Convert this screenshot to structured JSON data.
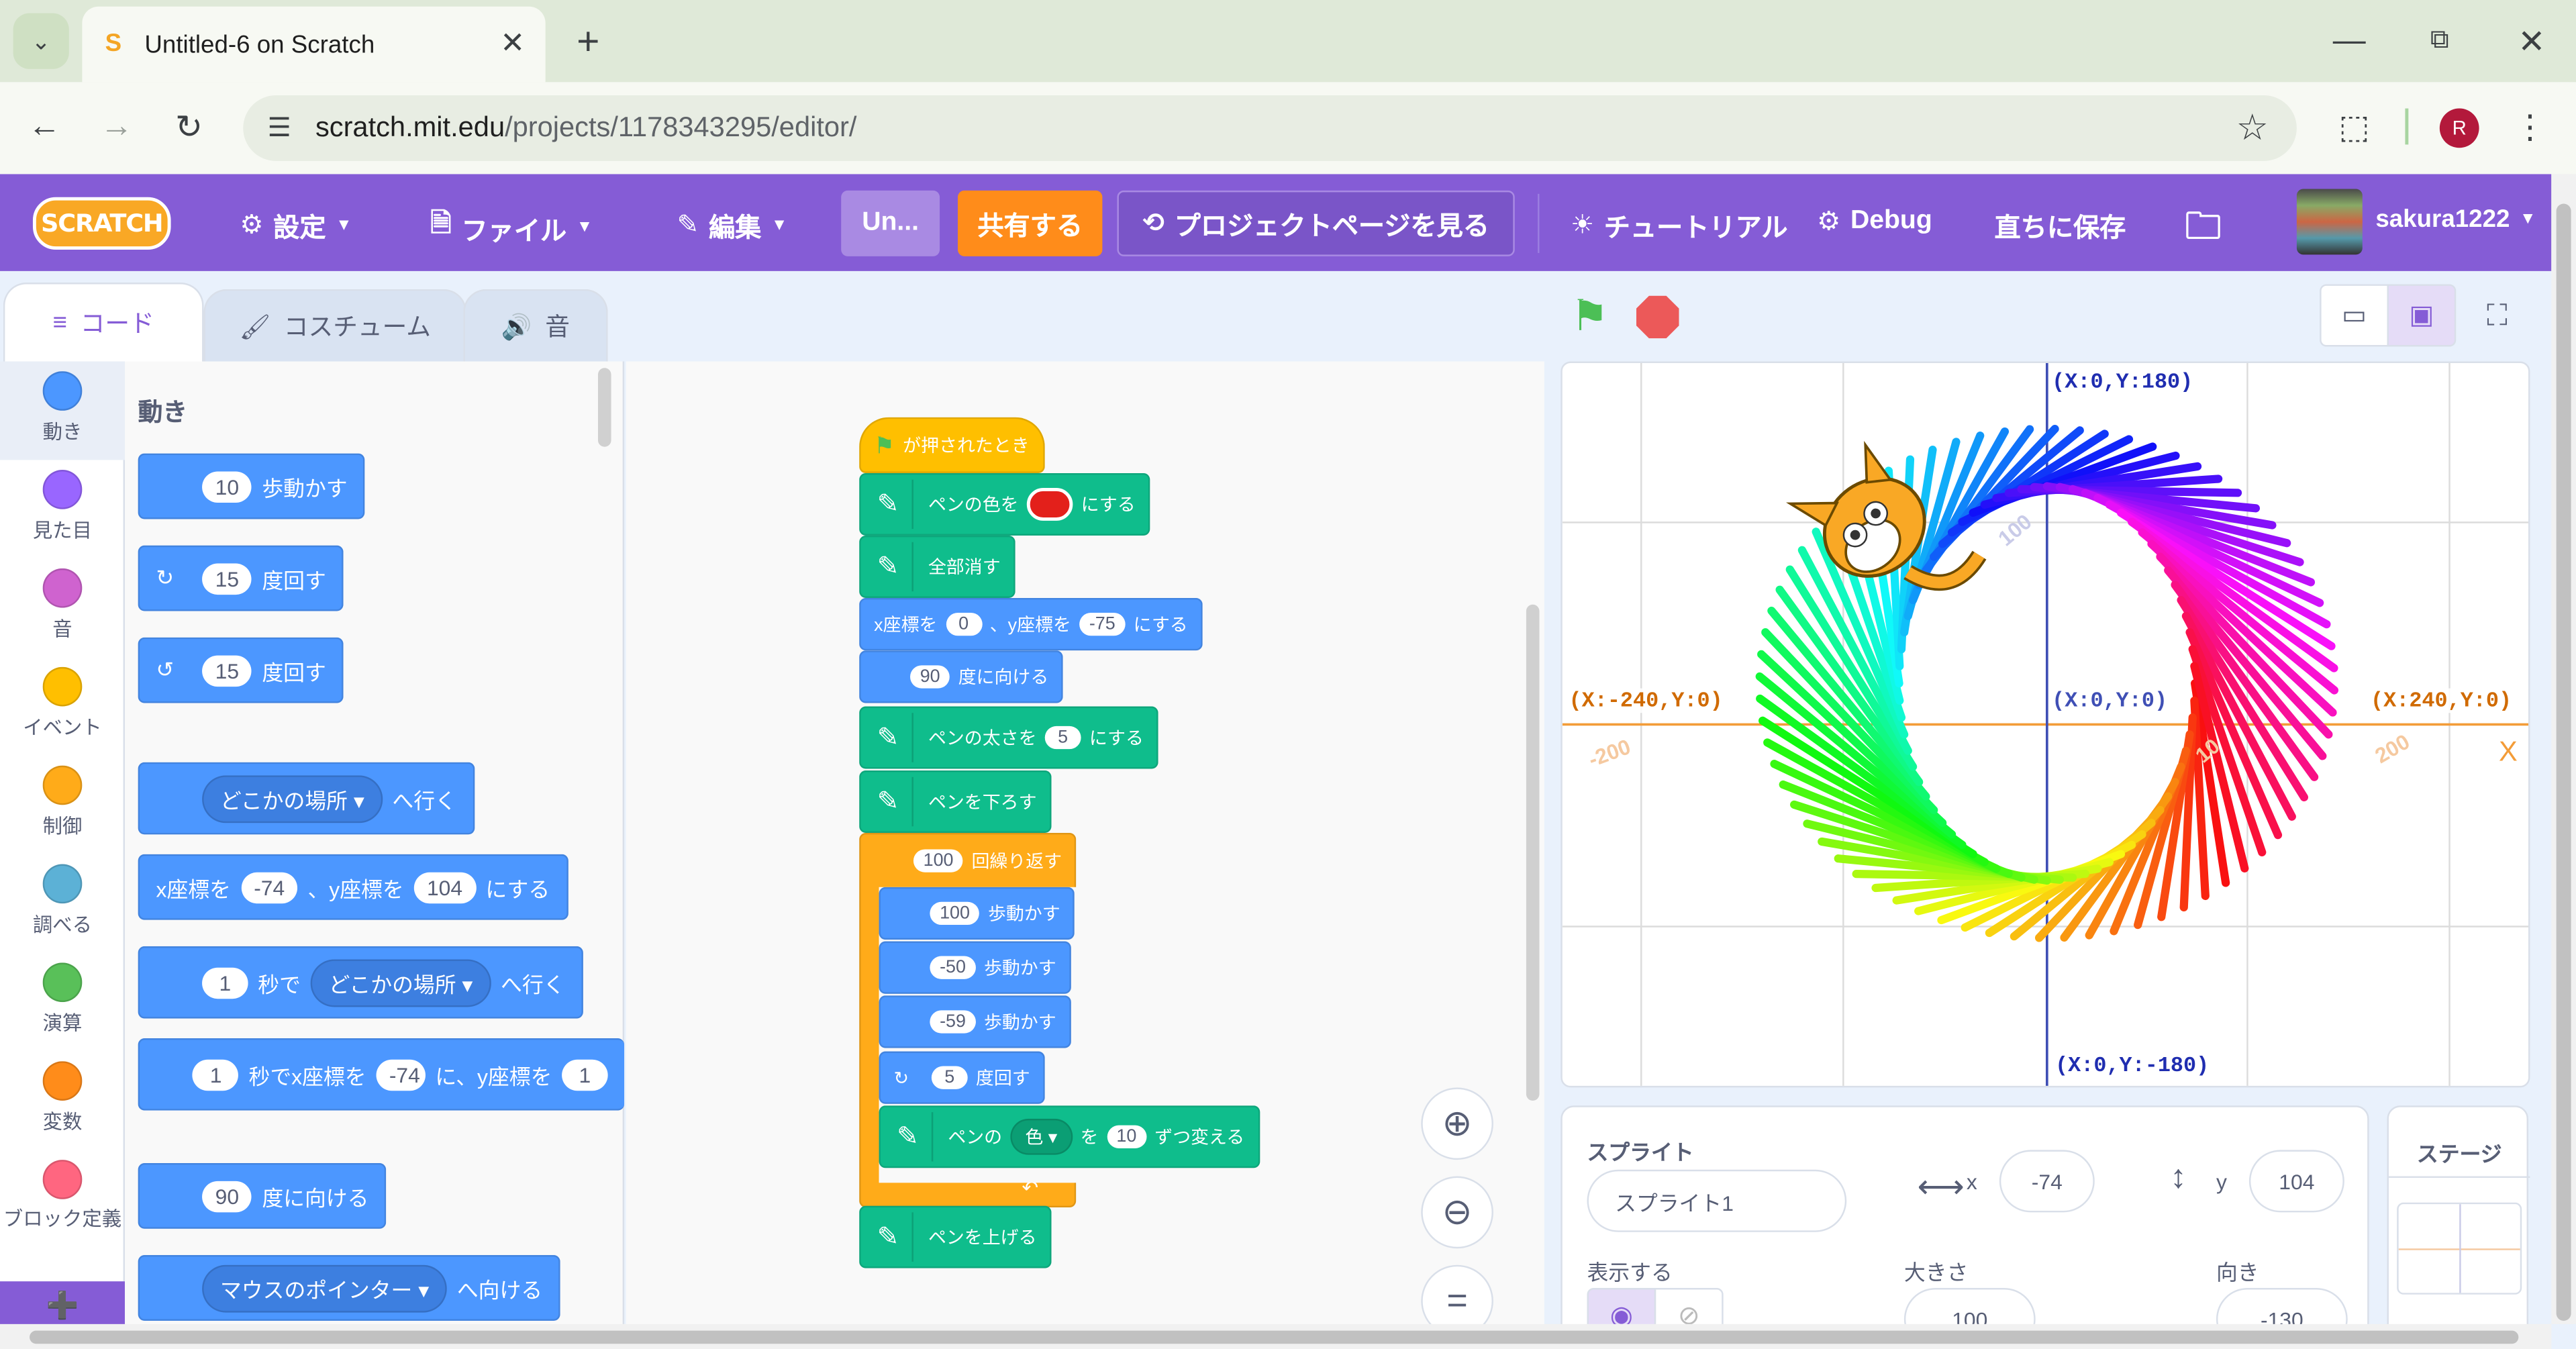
{
  "browser": {
    "tab_title": "Untitled-6 on Scratch",
    "url_domain": "scratch.mit.edu",
    "url_path": "/projects/1178343295/editor/",
    "profile_initial": "R"
  },
  "menubar": {
    "logo": "SCRATCH",
    "settings": "設定",
    "file": "ファイル",
    "edit": "編集",
    "project_title": "Un...",
    "share": "共有する",
    "see_project_page": "プロジェクトページを見る",
    "tutorials": "チュートリアル",
    "debug": "Debug",
    "save_now": "直ちに保存",
    "username": "sakura1222"
  },
  "editor_tabs": {
    "code": "コード",
    "costumes": "コスチューム",
    "sounds": "音"
  },
  "categories": [
    {
      "label": "動き",
      "color": "#4c97ff"
    },
    {
      "label": "見た目",
      "color": "#9966ff"
    },
    {
      "label": "音",
      "color": "#cf63cf"
    },
    {
      "label": "イベント",
      "color": "#ffbf00"
    },
    {
      "label": "制御",
      "color": "#ffab19"
    },
    {
      "label": "調べる",
      "color": "#5cb1d6"
    },
    {
      "label": "演算",
      "color": "#59c059"
    },
    {
      "label": "変数",
      "color": "#ff8c1a"
    },
    {
      "label": "ブロック定義",
      "color": "#ff6680"
    }
  ],
  "palette": {
    "heading": "動き",
    "move_steps": {
      "value": "10",
      "text": "歩動かす"
    },
    "turn_right": {
      "value": "15",
      "text": "度回す"
    },
    "turn_left": {
      "value": "15",
      "text": "度回す"
    },
    "goto_menu": {
      "value": "どこかの場所",
      "text": "へ行く"
    },
    "goto_xy": {
      "x_label": "x座標を",
      "x": "-74",
      "y_label": "、y座標を",
      "y": "104",
      "text": "にする"
    },
    "glide_to": {
      "secs": "1",
      "secs_label": "秒で",
      "value": "どこかの場所",
      "text": "へ行く"
    },
    "glide_xy": {
      "secs": "1",
      "x_label": "秒でx座標を",
      "x": "-74",
      "y_label": "に、y座標を",
      "y": "1"
    },
    "point_dir": {
      "value": "90",
      "text": "度に向ける"
    },
    "point_towards": {
      "value": "マウスのポインター",
      "text": "へ向ける"
    }
  },
  "script": {
    "hat": "が押されたとき",
    "pen_color": {
      "label": "ペンの色を",
      "text": "にする",
      "color": "#e3201b"
    },
    "clear": "全部消す",
    "goto": {
      "x_label": "x座標を",
      "x": "0",
      "y_label": "、y座標を",
      "y": "-75",
      "text": "にする"
    },
    "point": {
      "value": "90",
      "text": "度に向ける"
    },
    "pen_size": {
      "label": "ペンの太さを",
      "value": "5",
      "text": "にする"
    },
    "pen_down": "ペンを下ろす",
    "repeat": {
      "value": "100",
      "text": "回繰り返す"
    },
    "move1": {
      "value": "100",
      "text": "歩動かす"
    },
    "move2": {
      "value": "-50",
      "text": "歩動かす"
    },
    "move3": {
      "value": "-59",
      "text": "歩動かす"
    },
    "turn": {
      "value": "5",
      "text": "度回す"
    },
    "change_pen": {
      "label": "ペンの",
      "param": "色",
      "mid": "を",
      "value": "10",
      "text": "ずつ変える"
    },
    "pen_up": "ペンを上げる"
  },
  "stage": {
    "coords": {
      "top": "(X:0,Y:180)",
      "bottom": "(X:0,Y:-180)",
      "left": "(X:-240,Y:0)",
      "right": "(X:240,Y:0)",
      "center": "(X:0,Y:0)"
    },
    "axis_x_letter": "X",
    "tick_neg200": "-200",
    "tick_200": "200",
    "tick_100": "100",
    "tick_10": "10"
  },
  "sprite_info": {
    "sprite_heading": "スプライト",
    "sprite_name": "スプライト1",
    "x_label": "x",
    "x": "-74",
    "y_label": "y",
    "y": "104",
    "show_label": "表示する",
    "size_label": "大きさ",
    "size": "100",
    "direction_label": "向き",
    "direction": "-130"
  },
  "stage_pane": {
    "label": "ステージ"
  }
}
